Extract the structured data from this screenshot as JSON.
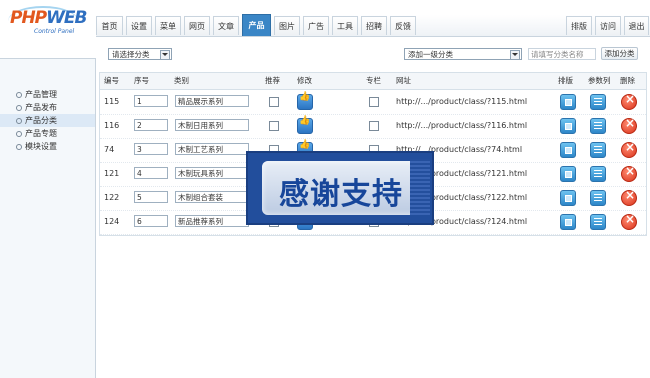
{
  "logo": {
    "brand_php": "PHP",
    "brand_web": "WEB",
    "subtitle": "Control Panel"
  },
  "topnav": {
    "tabs": [
      "首页",
      "设置",
      "菜单",
      "网页",
      "文章",
      "产品",
      "图片",
      "广告",
      "工具",
      "招聘",
      "反馈"
    ],
    "active_tab": "产品",
    "right": [
      "排版",
      "访问",
      "退出"
    ]
  },
  "sidebar": {
    "items": [
      "产品管理",
      "产品发布",
      "产品分类",
      "产品专题",
      "模块设置"
    ],
    "active_item": "产品分类"
  },
  "filter": {
    "category_select": "请选择分类",
    "add_parent_select": "添加一级分类",
    "name_placeholder": "请填写分类名称",
    "add_button": "添加分类"
  },
  "table": {
    "headers": [
      "编号",
      "序号",
      "类别",
      "推荐",
      "修改",
      "专栏",
      "网址",
      "排版",
      "参数列",
      "删除"
    ],
    "rows": [
      {
        "id": "115",
        "order": "1",
        "name": "精品展示系列",
        "url": "http://.../product/class/?115.html"
      },
      {
        "id": "116",
        "order": "2",
        "name": "木制日用系列",
        "url": "http://.../product/class/?116.html"
      },
      {
        "id": "74",
        "order": "3",
        "name": "木制工艺系列",
        "url": "http://.../product/class/?74.html"
      },
      {
        "id": "121",
        "order": "4",
        "name": "木制玩具系列",
        "url": "http://.../product/class/?121.html"
      },
      {
        "id": "122",
        "order": "5",
        "name": "木制组合套装",
        "url": "http://.../product/class/?122.html"
      },
      {
        "id": "124",
        "order": "6",
        "name": "新品推荐系列",
        "url": "http://.../product/class/?124.html"
      }
    ]
  },
  "watermark": {
    "text": "感谢支持"
  },
  "colors": {
    "active_tab": "#3a86c6",
    "delete": "#d9321a",
    "accent": "#2d86c8"
  }
}
